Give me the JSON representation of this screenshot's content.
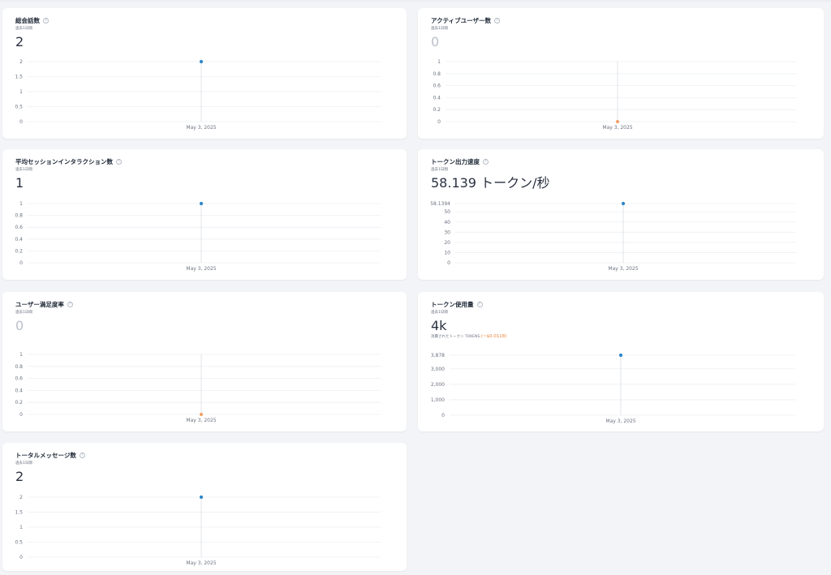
{
  "colors": {
    "point_blue": "#2e86c9",
    "point_orange": "#f4a26b",
    "grid": "#eceff3",
    "axis_text": "#6b7280"
  },
  "icons": {
    "help": "question-circle-icon"
  },
  "help_glyph": "?",
  "cards": [
    {
      "id": "total-sessions",
      "title": "総会話数",
      "subtitle": "過去1日間",
      "value": "2",
      "value_empty": false,
      "chart_data": {
        "type": "scatter",
        "x": [
          "May 3, 2025"
        ],
        "y": [
          2
        ],
        "ylim": [
          0,
          2
        ],
        "yticks": [
          0,
          0.5,
          1,
          1.5,
          2
        ],
        "ytick_labels": [
          "0",
          "0.5",
          "1",
          "1.5",
          "2"
        ],
        "point_color": "#2e86c9"
      }
    },
    {
      "id": "active-users",
      "title": "アクティブユーザー数",
      "subtitle": "過去1日間",
      "value": "0",
      "value_empty": true,
      "chart_data": {
        "type": "scatter",
        "x": [
          "May 3, 2025"
        ],
        "y": [
          0
        ],
        "ylim": [
          0,
          1
        ],
        "yticks": [
          0,
          0.2,
          0.4,
          0.6,
          0.8,
          1
        ],
        "ytick_labels": [
          "0",
          "0.2",
          "0.4",
          "0.6",
          "0.8",
          "1"
        ],
        "point_color": "#f4a26b"
      }
    },
    {
      "id": "avg-session-interactions",
      "title": "平均セッションインタラクション数",
      "subtitle": "過去1日間",
      "value": "1",
      "value_empty": false,
      "chart_data": {
        "type": "scatter",
        "x": [
          "May 3, 2025"
        ],
        "y": [
          1
        ],
        "ylim": [
          0,
          1
        ],
        "yticks": [
          0,
          0.2,
          0.4,
          0.6,
          0.8,
          1
        ],
        "ytick_labels": [
          "0",
          "0.2",
          "0.4",
          "0.6",
          "0.8",
          "1"
        ],
        "point_color": "#2e86c9"
      }
    },
    {
      "id": "token-output-speed",
      "title": "トークン出力速度",
      "subtitle": "過去1日間",
      "value": "58.139 トークン/秒",
      "value_empty": false,
      "chart_data": {
        "type": "scatter",
        "x": [
          "May 3, 2025"
        ],
        "y": [
          58.1394
        ],
        "ylim": [
          0,
          58.1394
        ],
        "yticks": [
          0,
          10,
          20,
          30,
          40,
          50,
          58.1394
        ],
        "ytick_labels": [
          "0",
          "10",
          "20",
          "30",
          "40",
          "50",
          "58.1394"
        ],
        "point_color": "#2e86c9"
      }
    },
    {
      "id": "user-satisfaction",
      "title": "ユーザー満足度率",
      "subtitle": "過去1日間",
      "value": "0",
      "value_empty": true,
      "chart_data": {
        "type": "scatter",
        "x": [
          "May 3, 2025"
        ],
        "y": [
          0
        ],
        "ylim": [
          0,
          1
        ],
        "yticks": [
          0,
          0.2,
          0.4,
          0.6,
          0.8,
          1
        ],
        "ytick_labels": [
          "0",
          "0.2",
          "0.4",
          "0.6",
          "0.8",
          "1"
        ],
        "point_color": "#f4a26b"
      }
    },
    {
      "id": "token-usage",
      "title": "トークン使用量",
      "subtitle": "過去1日間",
      "value": "4k",
      "value_empty": false,
      "token_note": "消費されたトークン TOKENS",
      "token_cost": "(~$0.0118)",
      "chart_data": {
        "type": "scatter",
        "x": [
          "May 3, 2025"
        ],
        "y": [
          3878
        ],
        "ylim": [
          0,
          3878
        ],
        "yticks": [
          0,
          1000,
          2000,
          3000,
          3878
        ],
        "ytick_labels": [
          "0",
          "1,000",
          "2,000",
          "3,000",
          "3,878"
        ],
        "point_color": "#2e86c9"
      }
    },
    {
      "id": "total-messages",
      "title": "トータルメッセージ数",
      "subtitle": "過去1日間",
      "value": "2",
      "value_empty": false,
      "chart_data": {
        "type": "scatter",
        "x": [
          "May 3, 2025"
        ],
        "y": [
          2
        ],
        "ylim": [
          0,
          2
        ],
        "yticks": [
          0,
          0.5,
          1,
          1.5,
          2
        ],
        "ytick_labels": [
          "0",
          "0.5",
          "1",
          "1.5",
          "2"
        ],
        "point_color": "#2e86c9"
      }
    }
  ]
}
